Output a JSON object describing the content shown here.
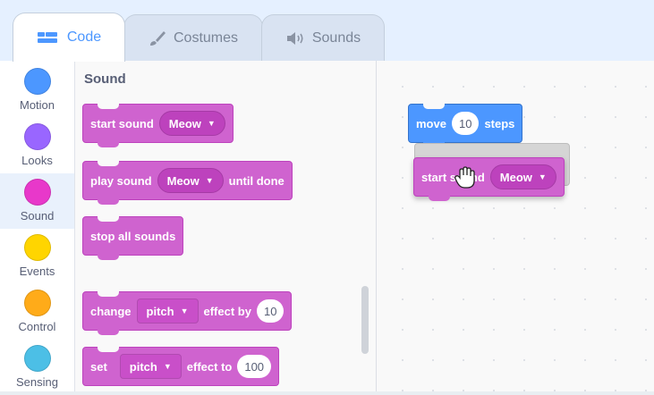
{
  "tabs": [
    {
      "label": "Code",
      "icon": "code-icon"
    },
    {
      "label": "Costumes",
      "icon": "brush-icon"
    },
    {
      "label": "Sounds",
      "icon": "speaker-icon"
    }
  ],
  "categories": [
    {
      "label": "Motion",
      "color": "#4c97ff"
    },
    {
      "label": "Looks",
      "color": "#9966ff"
    },
    {
      "label": "Sound",
      "color": "#cf63cf"
    },
    {
      "label": "Events",
      "color": "#ffd500"
    },
    {
      "label": "Control",
      "color": "#ffab19"
    },
    {
      "label": "Sensing",
      "color": "#5cb1d6"
    }
  ],
  "palette": {
    "title": "Sound",
    "start_sound": {
      "text": "start sound",
      "sound": "Meow"
    },
    "play_sound": {
      "text": "play sound",
      "sound": "Meow",
      "suffix": "until done"
    },
    "stop_all": {
      "text": "stop all sounds"
    },
    "change_effect": {
      "text": "change",
      "effect": "pitch",
      "mid": "effect by",
      "value": "10"
    },
    "set_effect": {
      "text": "set",
      "effect": "pitch",
      "mid": "effect to",
      "value": "100"
    }
  },
  "workspace": {
    "move": {
      "text": "move",
      "value": "10",
      "suffix": "steps"
    },
    "dragged": {
      "text": "start sound",
      "sound": "Meow"
    }
  },
  "colors": {
    "sound": "#cf63cf",
    "motion": "#4c97ff",
    "accent": "#4c97ff"
  }
}
